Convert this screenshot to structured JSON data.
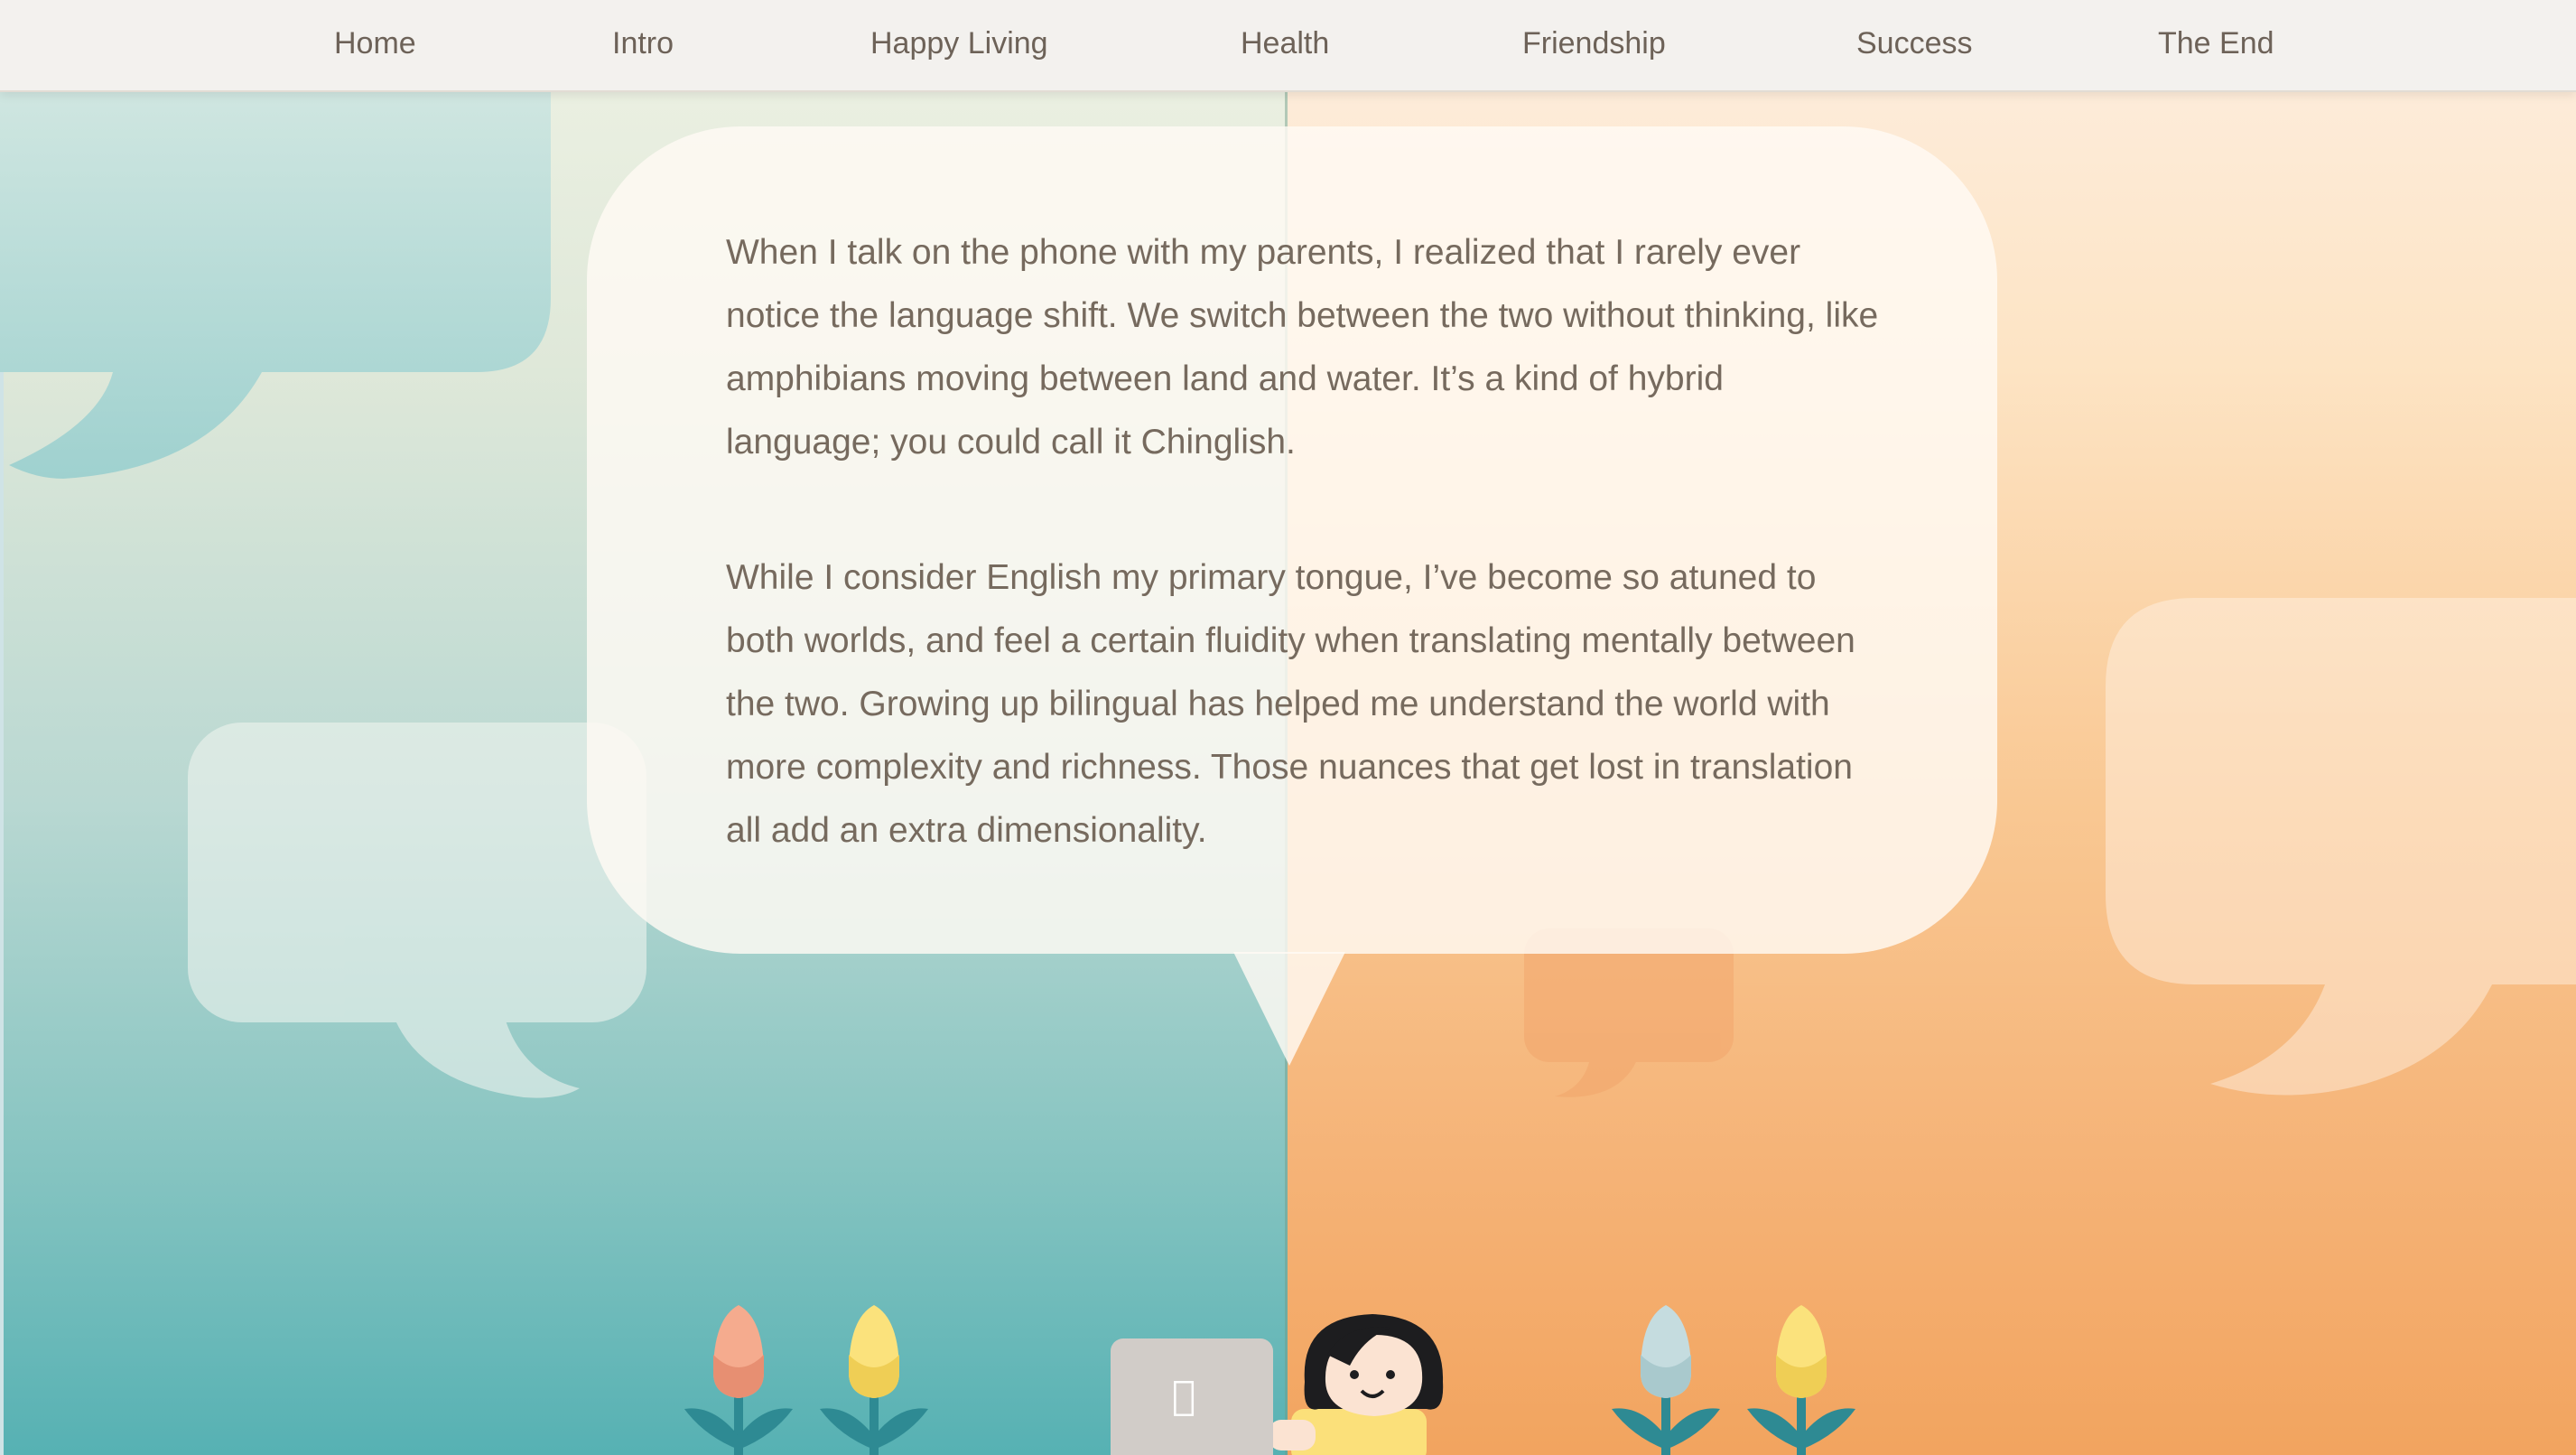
{
  "nav": {
    "items": [
      {
        "label": "Home"
      },
      {
        "label": "Intro"
      },
      {
        "label": "Happy Living"
      },
      {
        "label": "Health"
      },
      {
        "label": "Friendship"
      },
      {
        "label": "Success"
      },
      {
        "label": "The End"
      }
    ]
  },
  "story": {
    "paragraphs": [
      "When I talk on the phone with my parents, I realized that I rarely ever notice the language shift. We switch between the two without thinking, like amphibians moving between land and water. It’s a kind of hybrid language; you could call it Chinglish.",
      "While I consider English my primary tongue, I’ve become so atuned to both worlds, and feel a certain fluidity when translating mentally between the two. Growing up bilingual has helped me understand the world with more complexity and richness. Those nuances that get lost in translation all add an extra dimensionality."
    ]
  },
  "colors": {
    "left_panel": "#56b1b3",
    "right_panel": "#f2a45f",
    "nav_background": "#f3f1ee",
    "text": "#766a5e"
  },
  "icons": {
    "laptop_logo": "apple-logo-icon"
  }
}
